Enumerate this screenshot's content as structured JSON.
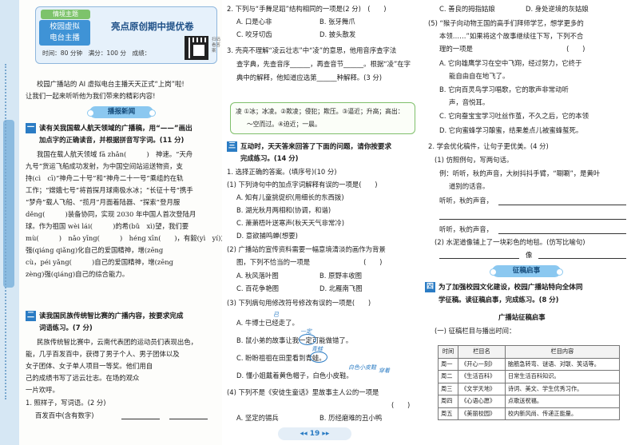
{
  "header": {
    "tag": "情境主题",
    "box_line1": "校园虚拟",
    "box_line2": "电台主播",
    "title": "亮点原创期中提优卷",
    "info": "时间：80 分钟　满分：100 分　成绩：",
    "qr_note": "扫码看答案"
  },
  "left": {
    "intro1": "校园广播站的 AI 虚拟电台主播天天正式“上岗”啦!",
    "intro2": "让我们一起来听听他为我们带来的精彩内容!",
    "pill1": "播报新闻",
    "sec1_num": "一",
    "sec1_title": "读有关我国载人航天领域的广播稿，用“——”画出",
    "sec1_title2": "加点字的正确读音，并根据拼音写字词。(11 分)",
    "p1": [
      "我国在载人航天领域 fā zhǎn(　　　)　神速。“天舟",
      "九号”货运飞船成功发射，为中国空间站运送物资，支",
      "持(cì　cī)“神舟二十号”和“神舟二十一号”乘组的在轨",
      "工作；“嫦娥七号”将首探月球南极水冰；“长征十号”携手",
      "“梦舟”载人飞船、“揽月”月面着陆器、“探索”登月服",
      "děng(　　　)装备协同，实现 2030 年中国人首次登陆月",
      "球。作为祖国 wèi lái(　　　)的希(bǔ　xì)望，我们要",
      "mù(　　　)　nǎo yīng(　　　)　héng xīn(　　)，有毅(yì　yí)力，",
      "强(qiáng qiǎng)化自己的爱国精神，增(zēng",
      "cù，péi yǎng(　　　)自己的爱国精神，增(zēng",
      "zèng)强(qiáng)自己的综合能力。"
    ],
    "sec2_num": "二",
    "sec2_title": "读我国民族传统智比赛的广播内容，按要求完成",
    "sec2_title2": "词语练习。(7 分)",
    "p2": [
      "民族传统智比赛中，云南代表团的运动员们表现出色，",
      "能，几乎百发百中，获得了男子个人、男子团体以及",
      "女子团体、女子单人项目一等奖。他们用自",
      "己的成绩书写了远云壮志。在场的观众",
      "一片欢呼。"
    ],
    "q1": "1. 照样子，写词语。(2 分)",
    "q1_example": "百发百中(含有数字)"
  },
  "mid": {
    "q2": "2. 下列与“手舞足蹈”结构相同的一项是(2 分)　(　　)",
    "q2_opts": [
      "A. 口是心非",
      "B. 张牙舞爪",
      "C. 咬牙切齿",
      "D. 披头散发"
    ],
    "q3": [
      "3. 壳亮不理解“凌云壮志”中“凌”的意思，他用音序查字法",
      "查字典，先查音序______，再查音节______。根据“凌”在字",
      "典中的解释，他知道应选第______种解释。(3 分)"
    ],
    "word_box": [
      "凌  ①冰；冰凌。②欺凌；侵犯；欺压。③逼近；升高；高出：",
      "～空而过。④迫近；一晨。"
    ],
    "sec3_num": "三",
    "sec3_title": "互动时，天天答来回答了下面的问题，请你按要求",
    "sec3_title2": "完成练习。(14 分)",
    "sub1": "1. 选择正确的答案。(填序号)(10 分)",
    "s1q1": "(1) 下列诗句中的加点字词解释有误的一项是(　　)",
    "s1q1_opts": [
      "A. 知有儿童挑促织(用细长的东西拨)",
      "B. 湖光秋月两相和(协调，和谐)",
      "C. 萧萧梧叶送寒声(秋天天气非常冷)",
      "D. 意欲捕鸣蝉(想要)"
    ],
    "s1q2": "(2) 广播站的宣传资料需要一幅意境清淡的画作为背景",
    "s1q2b": "图，下列不恰当的一项是　　　　　　　　(　　)",
    "s1q2_opts": [
      "A. 秋风落叶图",
      "B. 原野丰收图",
      "C. 百花争艳图",
      "D. 北雁南飞图"
    ],
    "s1q3": "(3) 下列病句用修改符号修改有误的一项是(　　)",
    "s1q3_opts": [
      "A. 牛博士已经走了。",
      "B. 鼠小弟的故事让我一定可能做错了。",
      "C. 盼盼祖祖在田里看到青蛙。",
      "D. 懂小姐戴着黄色帽子，白色小皮鞋。"
    ],
    "s1q4": "(4) 下列不是《安徒生童话》里故事主人公的一项是",
    "s1q4_paren": "(　　)",
    "s1q4_opts": [
      "A. 坚定的锡兵",
      "B. 历经磨难的丑小鸭"
    ],
    "edits": [
      "已",
      "一定",
      "青蛙",
      "白色小皮鞋",
      "穿着"
    ]
  },
  "right": {
    "top_opts": [
      "C. 善良的拇指姑娘",
      "D. 身处逆境的灰姑娘"
    ],
    "s1q5": [
      "(5) “猴子向动物王国的高手们拜师学艺，想学更多的",
      "本领……”如果将这个故事继续往下写，下列不合",
      "理的一项是　　　　　　　　　　　　　　(　　)"
    ],
    "s1q5_opts": [
      "A. 它向雄鹰学习在空中飞翔，经过努力，它终于",
      "能自由自在地飞了。",
      "B. 它向百灵鸟学习唱歌，它的歌声非常动听",
      "声，音悦耳。",
      "C. 它向蚕宝宝学习吐丝作茧，不久之后，它的本领",
      "D. 它向蜜蜂学习酿蜜，结果差点儿被蜜蜂蜇死。"
    ],
    "sub2": "2. 学会优化稿件，让句子更优美。(4 分)",
    "s2q1": "(1) 仿照例句，写两句话。",
    "s2q1_ex": [
      "例：听听，秋的声音，大树抖抖手臂，“唰唰”，是黄叶",
      "道别的话音。"
    ],
    "listen1": "听听，秋的声音，",
    "listen2": "听听，秋的声音，",
    "s2q2": "(2) 水泥道像铺上了一块彩色的地毯。(仿写比喻句)",
    "s2q2_end": "像",
    "pill2": "征稿启事",
    "sec4_num": "四",
    "sec4_title": "为了加强校园文化建设，校园广播站特向全体同",
    "sec4_title2": "学征稿。读征稿启事，完成练习。(8 分)",
    "notice_title": "广播站征稿启事",
    "notice_sub": "(一) 征稿栏目与播出时间：",
    "table_head": [
      "时间",
      "栏目名",
      "栏目内容"
    ],
    "table_rows": [
      [
        "周一",
        "《开心一刻》",
        "脑筋急转弯、谜语、对联、笑话等。"
      ],
      [
        "周二",
        "《生活百科》",
        "日常生活百科知识。"
      ],
      [
        "周三",
        "《文学天地》",
        "诗词、美文、学生优秀习作。"
      ],
      [
        "周四",
        "《心语心愿》",
        "点歌送祝福。"
      ],
      [
        "周五",
        "《美丽校园》",
        "校内新风尚、传递正能量。"
      ]
    ]
  },
  "footer": {
    "page": "19"
  }
}
